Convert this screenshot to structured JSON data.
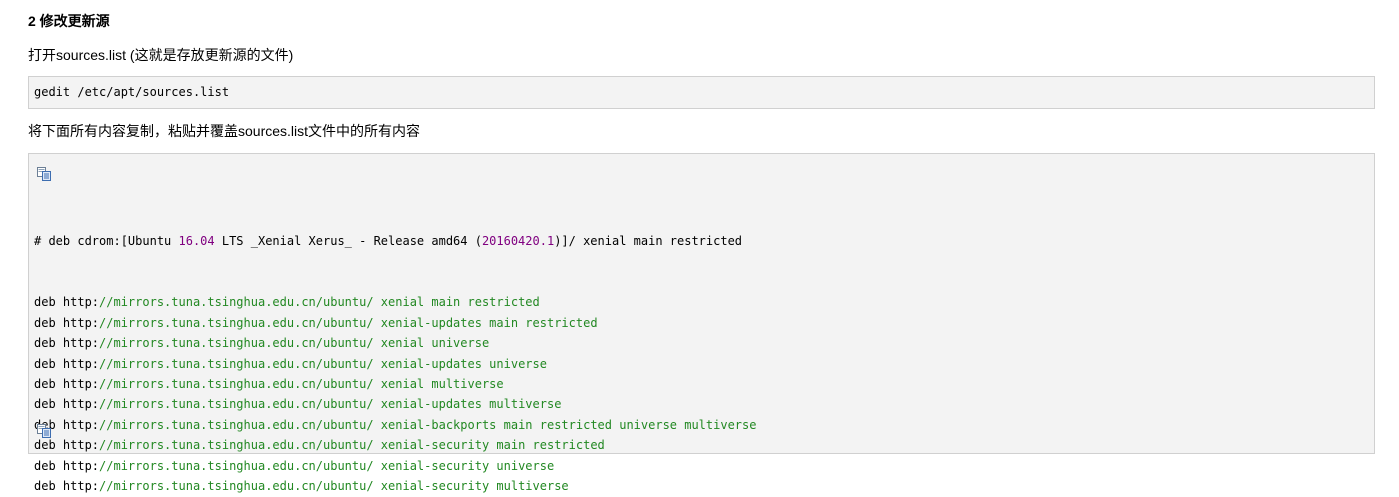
{
  "heading": "2 修改更新源",
  "intro_text": "打开sources.list (这就是存放更新源的文件)",
  "command": "gedit /etc/apt/sources.list",
  "instruction_text": "将下面所有内容复制，粘贴并覆盖sources.list文件中的所有内容",
  "icons": {
    "copy_top": "copy-icon",
    "copy_bottom": "copy-icon"
  },
  "colors": {
    "number": "#800080",
    "string": "#228822",
    "code_background": "#f3f3f3"
  },
  "comment_line": {
    "part1": "# deb cdrom:[Ubuntu ",
    "version": "16.04",
    "part2": " LTS _Xenial Xerus_ - Release amd64 (",
    "date": "20160420.1",
    "part3": ")]/ xenial main restricted"
  },
  "source_lines": [
    {
      "prefix": "deb http:",
      "url": "//mirrors.tuna.tsinghua.edu.cn/ubuntu/",
      "rest": " xenial main restricted"
    },
    {
      "prefix": "deb http:",
      "url": "//mirrors.tuna.tsinghua.edu.cn/ubuntu/",
      "rest": " xenial-updates main restricted"
    },
    {
      "prefix": "deb http:",
      "url": "//mirrors.tuna.tsinghua.edu.cn/ubuntu/",
      "rest": " xenial universe"
    },
    {
      "prefix": "deb http:",
      "url": "//mirrors.tuna.tsinghua.edu.cn/ubuntu/",
      "rest": " xenial-updates universe"
    },
    {
      "prefix": "deb http:",
      "url": "//mirrors.tuna.tsinghua.edu.cn/ubuntu/",
      "rest": " xenial multiverse"
    },
    {
      "prefix": "deb http:",
      "url": "//mirrors.tuna.tsinghua.edu.cn/ubuntu/",
      "rest": " xenial-updates multiverse"
    },
    {
      "prefix": "deb http:",
      "url": "//mirrors.tuna.tsinghua.edu.cn/ubuntu/",
      "rest": " xenial-backports main restricted universe multiverse"
    },
    {
      "prefix": "deb http:",
      "url": "//mirrors.tuna.tsinghua.edu.cn/ubuntu/",
      "rest": " xenial-security main restricted"
    },
    {
      "prefix": "deb http:",
      "url": "//mirrors.tuna.tsinghua.edu.cn/ubuntu/",
      "rest": " xenial-security universe"
    },
    {
      "prefix": "deb http:",
      "url": "//mirrors.tuna.tsinghua.edu.cn/ubuntu/",
      "rest": " xenial-security multiverse"
    }
  ]
}
